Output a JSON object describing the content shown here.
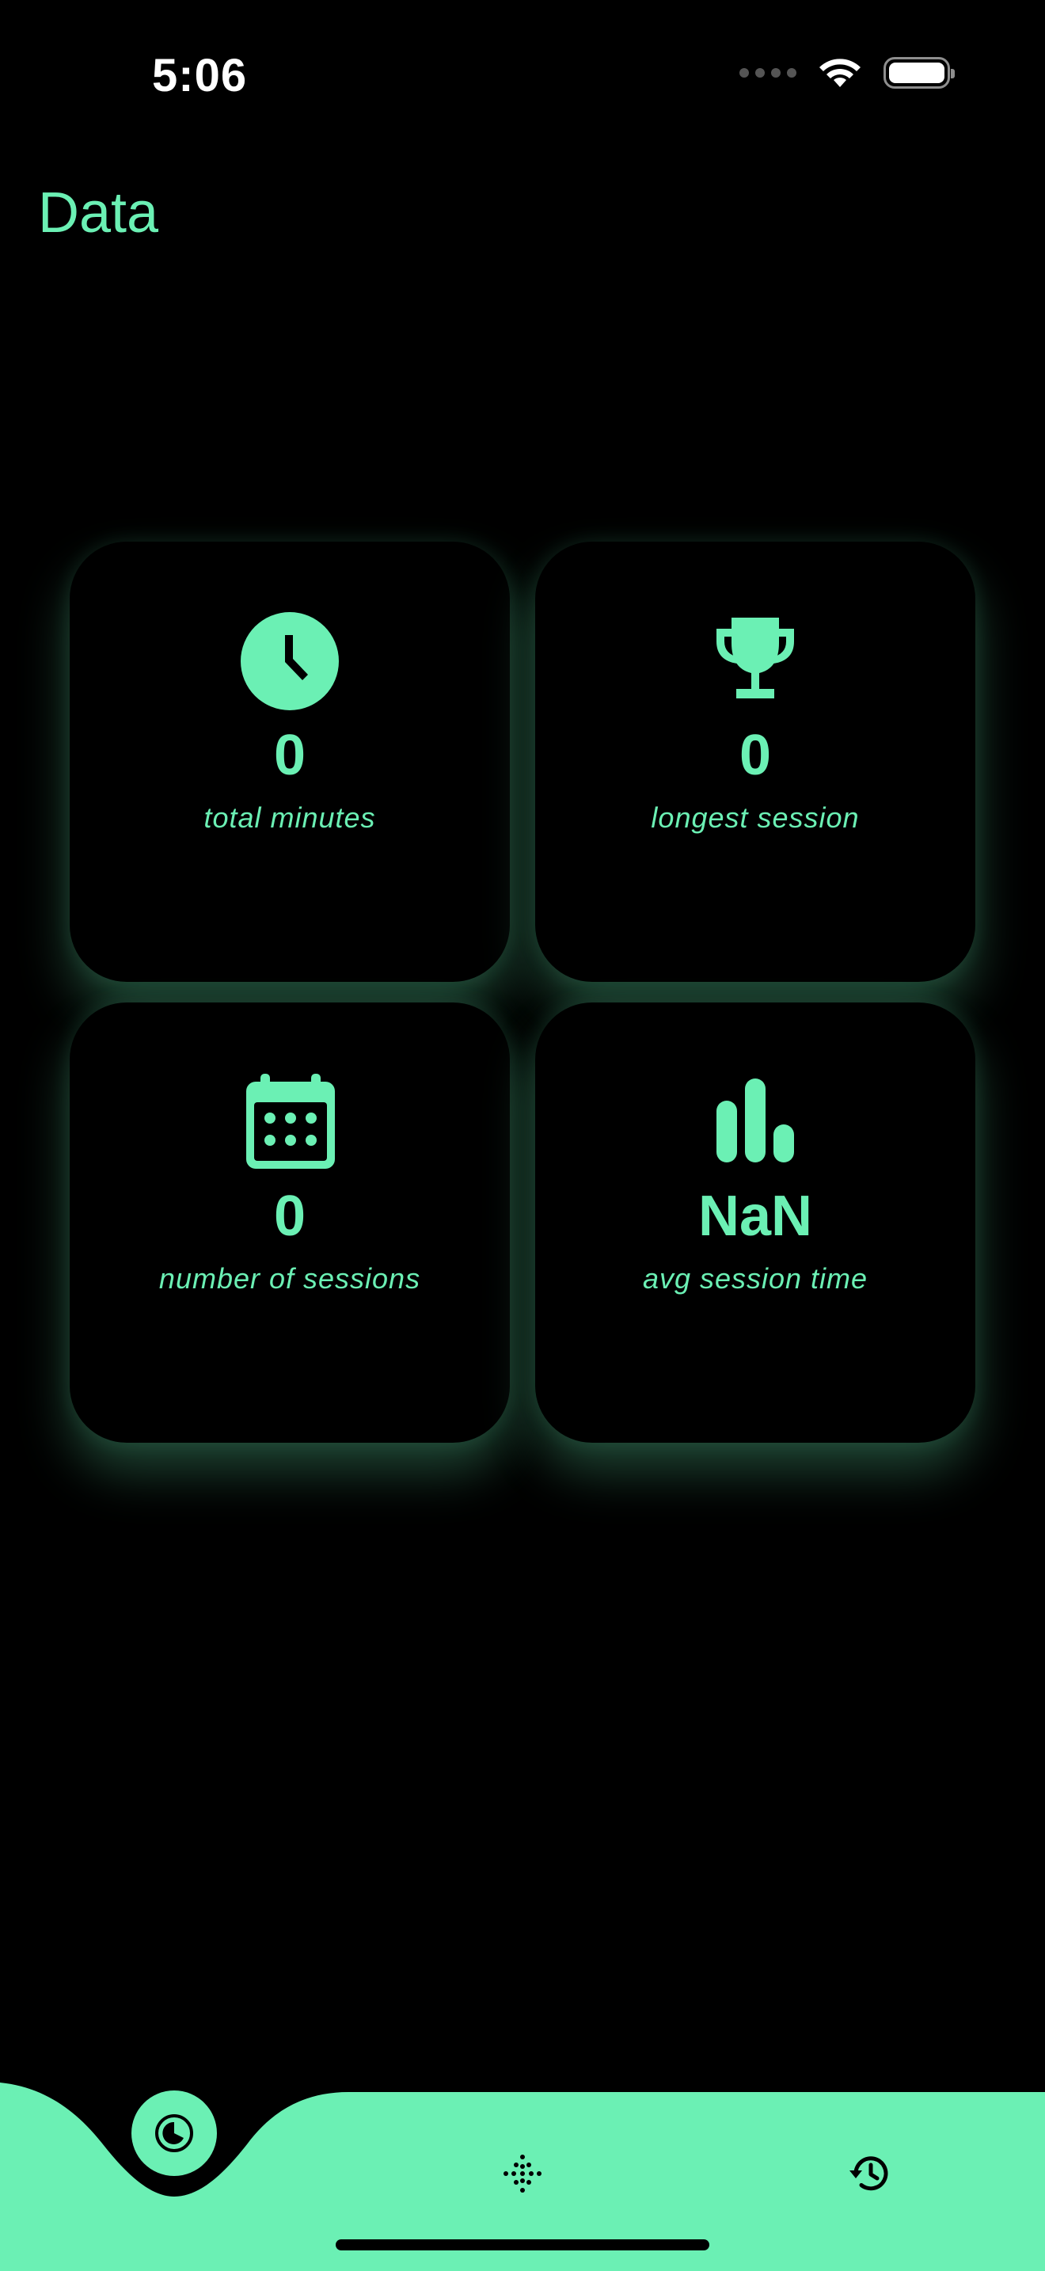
{
  "status_bar": {
    "time": "5:06"
  },
  "page": {
    "title": "Data"
  },
  "theme": {
    "accent": "#6BF0B4",
    "background": "#000000"
  },
  "stats": [
    {
      "icon": "clock-icon",
      "value": "0",
      "label": "total minutes"
    },
    {
      "icon": "trophy-icon",
      "value": "0",
      "label": "longest session"
    },
    {
      "icon": "calendar-icon",
      "value": "0",
      "label": "number of sessions"
    },
    {
      "icon": "bar-chart-icon",
      "value": "NaN",
      "label": "avg session time"
    }
  ],
  "tab_bar": {
    "tabs": [
      {
        "icon": "data-pie-icon",
        "active": true
      },
      {
        "icon": "breathe-dots-icon",
        "active": false
      },
      {
        "icon": "history-icon",
        "active": false
      }
    ]
  }
}
